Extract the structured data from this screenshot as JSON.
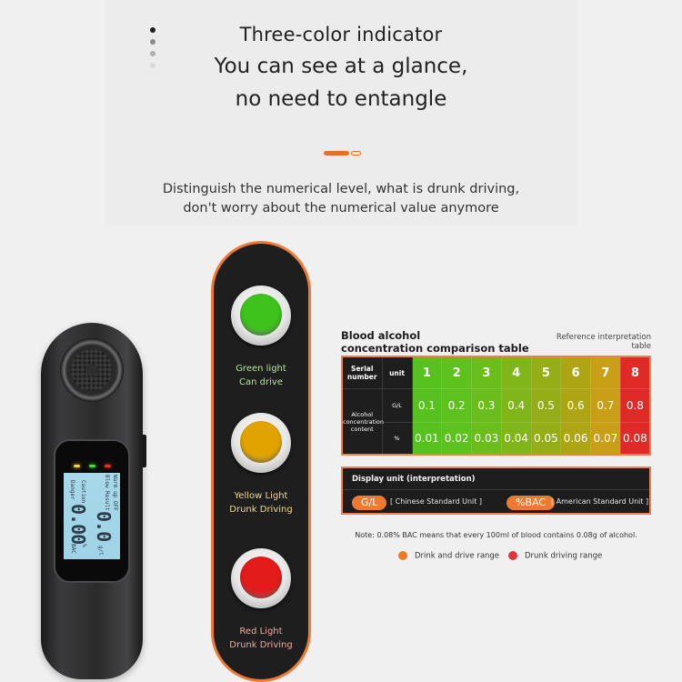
{
  "header": {
    "title": "Three-color indicator",
    "headline_line1": "You can see at a glance,",
    "headline_line2": "no need to entangle",
    "subtitle_line1": "Distinguish the numerical level, what is drunk driving,",
    "subtitle_line2": "don't worry about the numerical value anymore",
    "side_dots": [
      "#1c1c1c",
      "#8a8a8a",
      "#b0b0b0",
      "#d8d8d8"
    ],
    "pager": {
      "active_index": 0,
      "count": 2
    }
  },
  "indicator": {
    "accent": "#ee7b35",
    "lights": [
      {
        "name": "green",
        "color": "#3ec21c",
        "line1": "Green light",
        "line2": "Can drive",
        "label_color": "#b6e39a"
      },
      {
        "name": "yellow",
        "color": "#e2a300",
        "line1": "Yellow Light",
        "line2": "Drunk Driving",
        "label_color": "#f2d88c"
      },
      {
        "name": "red",
        "color": "#e41b1b",
        "line1": "Red Light",
        "line2": "Drunk Driving",
        "label_color": "#f0a8a0"
      }
    ]
  },
  "device": {
    "leds": [
      "#f2d23a",
      "#3fdc44",
      "#ff2b2b"
    ],
    "lcd": {
      "warmup": "Warm up OFF",
      "blow": "Blow Result",
      "caution": "Caution",
      "danger": "Danger",
      "reading_gl": "0.0",
      "unit_gl": "g/l",
      "reading_bac": "0.00",
      "unit_pct": "%",
      "unit_bac": "BAC"
    }
  },
  "table": {
    "title_line1": "Blood alcohol",
    "title_line2": "concentration comparison table",
    "ref_line1": "Reference interpretation",
    "ref_line2": "table",
    "header_serial": "Serial number",
    "header_unit": "unit",
    "row_label": "Alcohol concentration content",
    "unit_gl": "G/L",
    "unit_pct": "%",
    "columns": [
      {
        "serial": "1",
        "gl": "0.1",
        "pct": "0.01",
        "color": "#57c21f"
      },
      {
        "serial": "2",
        "gl": "0.2",
        "pct": "0.02",
        "color": "#5ec21e"
      },
      {
        "serial": "3",
        "gl": "0.3",
        "pct": "0.03",
        "color": "#6bbd1c"
      },
      {
        "serial": "4",
        "gl": "0.4",
        "pct": "0.04",
        "color": "#80b61a"
      },
      {
        "serial": "5",
        "gl": "0.5",
        "pct": "0.05",
        "color": "#95ad17"
      },
      {
        "serial": "6",
        "gl": "0.6",
        "pct": "0.06",
        "color": "#aea515"
      },
      {
        "serial": "7",
        "gl": "0.7",
        "pct": "0.07",
        "color": "#c89f16"
      },
      {
        "serial": "8",
        "gl": "0.8",
        "pct": "0.08",
        "color": "#e02a28"
      }
    ]
  },
  "display_unit": {
    "title": "Display unit (interpretation)",
    "units": [
      {
        "badge": "G/L",
        "desc": "[ Chinese Standard Unit ]"
      },
      {
        "badge": "%BAC",
        "desc": "[ American Standard Unit ]"
      }
    ]
  },
  "note": "Note: 0.08% BAC means that every 100ml of blood contains 0.08g of alcohol.",
  "legend": [
    {
      "label": "Drink and drive range",
      "color": "#ee7a25"
    },
    {
      "label": "Drunk driving range",
      "color": "#e2343f"
    }
  ]
}
